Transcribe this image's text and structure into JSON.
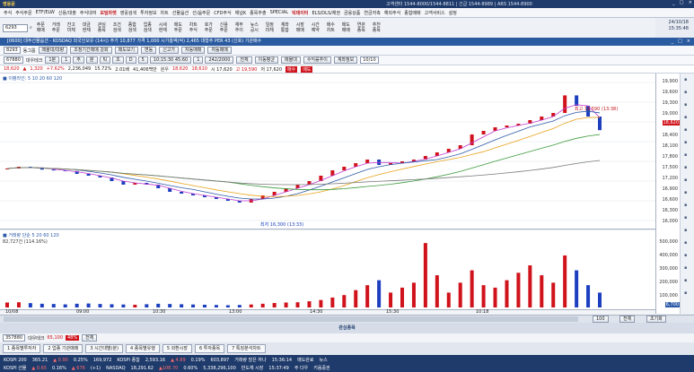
{
  "titlebar": {
    "app": "영웅문",
    "info": "고객센터 1544-8000/1544-8811 | 긴급 1544-8989 | ARS 1544-8900"
  },
  "menu": [
    "주식",
    "주식주문",
    "ETF/ELW",
    "신용/대출",
    "주식대여",
    "모빌마켓",
    "영웅검색",
    "투자정보",
    "차트",
    "선물옵션",
    "선/옵주문",
    "CFD주식",
    "채널K",
    "종목추출",
    "SPECIAL",
    "빅데이터",
    "ELS/DLS/채권",
    "금융상품",
    "연금저축",
    "해외주식",
    "종합매매",
    "고객서비스",
    "설정"
  ],
  "menu_highlight": [
    5,
    15
  ],
  "datetime": {
    "date": "24/10/18",
    "time": "15:35:48"
  },
  "toolbar": {
    "search_value": "6293",
    "groups": [
      [
        "주문",
        "매매"
      ],
      [
        "거래",
        "주문"
      ],
      [
        "잔고",
        "미체"
      ],
      [
        "대금",
        "현재"
      ],
      [
        "관심",
        "종목"
      ],
      [
        "조건",
        "검색"
      ],
      [
        "종합",
        "검색"
      ],
      [
        "업종",
        "검색"
      ],
      [
        "시세",
        "현재"
      ],
      [
        "매도",
        "주문"
      ],
      [
        "차트",
        "주식"
      ],
      [
        "호가",
        "주문"
      ],
      [
        "신용",
        "주문"
      ],
      [
        "재무",
        "추이"
      ],
      [
        "뉴스",
        "공시"
      ],
      [
        "일정",
        "미체"
      ],
      [
        "계좌",
        "통합"
      ],
      [
        "시장",
        "매매"
      ],
      [
        "시간",
        "예약"
      ],
      [
        "매수",
        "차트"
      ],
      [
        "매도",
        "매매"
      ],
      [
        "연관",
        "종목"
      ],
      [
        "추천",
        "종목"
      ]
    ]
  },
  "window": {
    "title": "[0600] 대주선물옵션 - KOSDAQ 외국인보유 (14시) 주가 10,877 가격 1,000 시가총액(억) 2,465 대형주 PER 43 (신호) 기관매수",
    "ctl": [
      "_",
      "□",
      "×"
    ]
  },
  "row1": {
    "code": "8293",
    "name": "동그룹",
    "btns": [
      "매물대/대량",
      "조정기간매매 강화",
      "매도보기",
      "변동",
      "신고가",
      "자동매매",
      "자동매매"
    ]
  },
  "row2": {
    "code": "67880",
    "name": "대우테크",
    "fields": [
      "1분",
      "1",
      "주",
      "분",
      "틱",
      "초",
      "D",
      "5",
      "10:15:30 45:60",
      "1",
      "242/2000"
    ],
    "btns": [
      "전체",
      "이동평균",
      "매물대",
      "수익률추이",
      "계좌정보"
    ],
    "count": "10/10"
  },
  "row3": {
    "items": [
      "18,620",
      "▲",
      "1,320",
      "+7.62%",
      "2,236,049",
      "15.72%",
      "2.01배",
      "41,406백만",
      "원우",
      "18,620",
      "18,610",
      "시 17,620",
      "고 19,590",
      "저 17,620",
      "매수",
      "매도"
    ],
    "redbg": [
      "매수",
      "매도"
    ]
  },
  "price_chart": {
    "legend": "■ 이평라인: 5 10 20 60 120",
    "high_label": "최고 19,590 (13:38)",
    "low_label": "최저 16,300 (13:33)",
    "yaxis": [
      "19,900",
      "19,600",
      "19,300",
      "19,000",
      "18,700",
      "18,400",
      "18,100",
      "17,800",
      "17,500",
      "17,200",
      "16,900",
      "16,600",
      "16,300",
      "16,000"
    ],
    "price_box": "18,620"
  },
  "vol_chart": {
    "legend": "■ 거래량 단순 5 20 60 120",
    "sub": "82,727건 (114.16%)",
    "yaxis": [
      "500,000",
      "400,000",
      "300,000",
      "200,000",
      "100,000"
    ],
    "box": "6,700"
  },
  "xaxis": [
    "10/08",
    "09:00",
    "10:30",
    "13:00",
    "14:30",
    "15:30",
    "10:18"
  ],
  "chart_data": {
    "type": "line",
    "title": "",
    "xlabel": "",
    "ylabel": "",
    "ylim": [
      16000,
      20000
    ],
    "series": [
      {
        "values": [
          17550,
          17600,
          17580,
          17520,
          17500,
          17480,
          17400,
          17350,
          17300,
          17200,
          17100,
          17150,
          17100,
          17000,
          16900,
          16850,
          16800,
          16750,
          16700,
          16650,
          16600,
          16700,
          16800,
          16900,
          17000,
          17100,
          17200,
          17350,
          17500,
          17600,
          17700,
          17800,
          17650,
          17700,
          17750,
          17800,
          17900,
          18000,
          18100,
          18200,
          18500,
          18600,
          18700,
          18750,
          18800,
          18900,
          19000,
          19100,
          19590,
          19300,
          19000,
          18620
        ]
      }
    ],
    "volume": [
      40,
      42,
      35,
      30,
      28,
      25,
      30,
      32,
      28,
      26,
      24,
      22,
      26,
      30,
      28,
      26,
      24,
      22,
      20,
      18,
      20,
      24,
      30,
      36,
      40,
      42,
      50,
      60,
      80,
      100,
      140,
      180,
      220,
      120,
      160,
      200,
      520,
      260,
      120,
      200,
      300,
      180,
      160,
      220,
      280,
      340,
      260,
      200,
      420,
      300,
      180,
      120
    ]
  },
  "scroll": {
    "zoom": "100",
    "btn_all": "전체",
    "btn_reset": "초기화"
  },
  "bp_toolbar": {
    "code": "357880",
    "name": "대우테크",
    "vol": "65,100",
    "pct": "48%",
    "view": "전체"
  },
  "bp_tabs": [
    "1 종목별투자자",
    "2 업종 기관매매",
    "3 시간대별(분)",
    "4 종목별유행",
    "5 외환시장",
    "6 투자종목",
    "7 특징분석차트"
  ],
  "bp_mid": "관심종목",
  "statusbar": {
    "row1": [
      "KOSPI 200",
      "365.21",
      "▲ 0.90",
      "0.25%",
      "169,972",
      "KOSPI 종합",
      "2,593.16",
      "▲ 4.89",
      "0.19%",
      "603,897",
      "거래량 많은 하나",
      "15:36:14",
      "매도완료",
      "뉴스"
    ],
    "row2": [
      "KOSPI 선물",
      "▲ 0.65",
      "0.16%",
      "▲ 676",
      "(+1)",
      "NASDAQ",
      "18,291.62",
      "▲108.70",
      "0.60%",
      "5,338,296,100",
      "반도체 시장",
      "15:37:49",
      "주 다우",
      "키움증권"
    ]
  }
}
